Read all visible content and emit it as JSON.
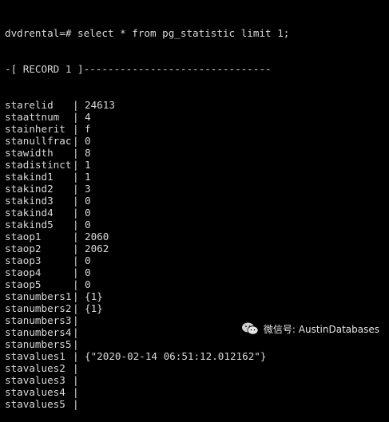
{
  "terminal": {
    "prompt": "dvdrental=# ",
    "command": "select * from pg_statistic limit 1;",
    "record_header": "-[ RECORD 1 ]-------------------------------",
    "rows": [
      {
        "field": "starelid",
        "value": "24613"
      },
      {
        "field": "staattnum",
        "value": "4"
      },
      {
        "field": "stainherit",
        "value": "f"
      },
      {
        "field": "stanullfrac",
        "value": "0"
      },
      {
        "field": "stawidth",
        "value": "8"
      },
      {
        "field": "stadistinct",
        "value": "1"
      },
      {
        "field": "stakind1",
        "value": "1"
      },
      {
        "field": "stakind2",
        "value": "3"
      },
      {
        "field": "stakind3",
        "value": "0"
      },
      {
        "field": "stakind4",
        "value": "0"
      },
      {
        "field": "stakind5",
        "value": "0"
      },
      {
        "field": "staop1",
        "value": "2060"
      },
      {
        "field": "staop2",
        "value": "2062"
      },
      {
        "field": "staop3",
        "value": "0"
      },
      {
        "field": "staop4",
        "value": "0"
      },
      {
        "field": "staop5",
        "value": "0"
      },
      {
        "field": "stanumbers1",
        "value": "{1}"
      },
      {
        "field": "stanumbers2",
        "value": "{1}"
      },
      {
        "field": "stanumbers3",
        "value": ""
      },
      {
        "field": "stanumbers4",
        "value": ""
      },
      {
        "field": "stanumbers5",
        "value": ""
      },
      {
        "field": "stavalues1",
        "value": "{\"2020-02-14 06:51:12.012162\"}"
      },
      {
        "field": "stavalues2",
        "value": ""
      },
      {
        "field": "stavalues3",
        "value": ""
      },
      {
        "field": "stavalues4",
        "value": ""
      },
      {
        "field": "stavalues5",
        "value": ""
      }
    ],
    "separator": "|"
  },
  "watermark": {
    "icon": "wechat-icon",
    "text": "微信号: AustinDatabases"
  }
}
